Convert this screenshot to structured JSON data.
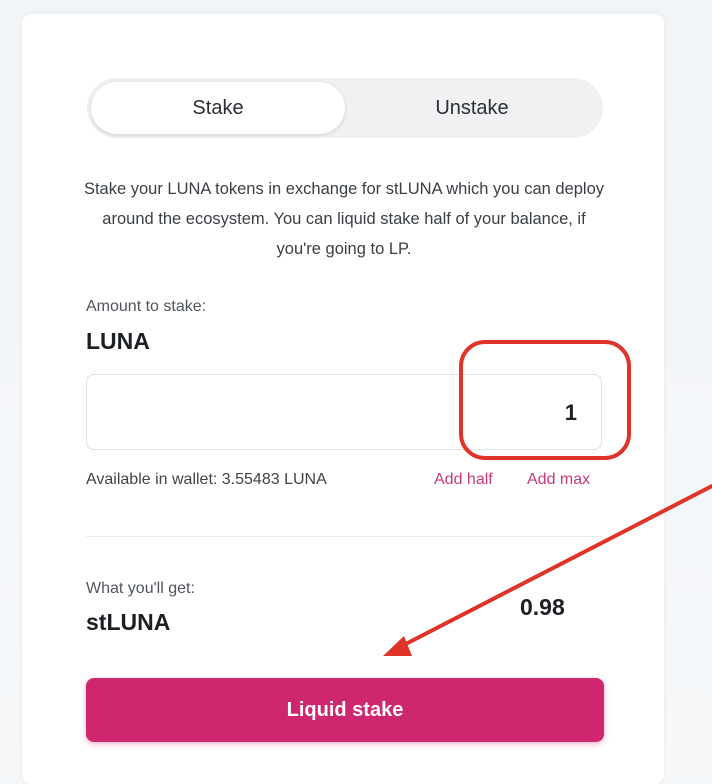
{
  "tabs": {
    "stake": "Stake",
    "unstake": "Unstake",
    "active": "Stake"
  },
  "description": "Stake your LUNA tokens in exchange for stLUNA which you can deploy around the ecosystem. You can liquid stake half of your balance, if you're going to LP.",
  "amount": {
    "label": "Amount to stake:",
    "token": "LUNA",
    "value": "1"
  },
  "wallet": {
    "available_text": "Available in wallet: 3.55483 LUNA",
    "add_half": "Add half",
    "add_max": "Add max"
  },
  "receive": {
    "label": "What you'll get:",
    "token": "stLUNA",
    "value": "0.98"
  },
  "action": {
    "submit_label": "Liquid stake"
  },
  "colors": {
    "accent": "#cf2670",
    "annotation": "#e0332a",
    "link": "#c9397a"
  }
}
